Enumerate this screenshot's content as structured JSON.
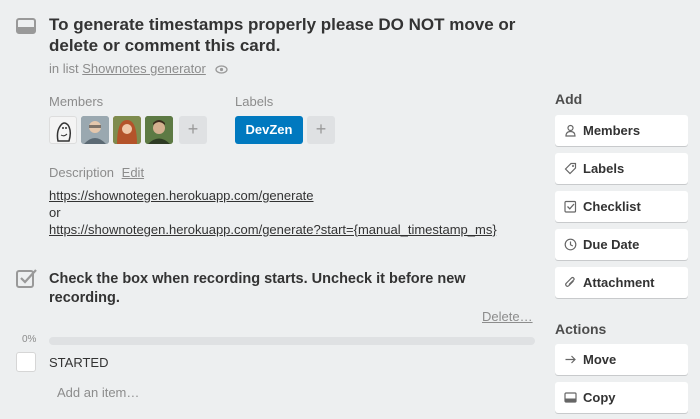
{
  "card": {
    "title": "To generate timestamps properly please DO NOT move or delete or comment this card.",
    "in_list_prefix": "in list",
    "list_name": "Shownotes generator"
  },
  "members": {
    "heading": "Members",
    "add": "+"
  },
  "labels": {
    "heading": "Labels",
    "items": [
      {
        "text": "DevZen",
        "color": "#0079bf"
      }
    ],
    "add": "+"
  },
  "description": {
    "heading": "Description",
    "edit": "Edit",
    "line1": "https://shownotegen.herokuapp.com/generate",
    "line2": "or",
    "line3": "https://shownotegen.herokuapp.com/generate?start={manual_timestamp_ms}"
  },
  "checklist": {
    "title": "Check the box when recording starts. Uncheck it before new recording.",
    "delete": "Delete…",
    "progress_label": "0%",
    "progress": 0,
    "items": [
      {
        "text": "STARTED",
        "checked": false
      }
    ],
    "add_placeholder": "Add an item…"
  },
  "sidebar": {
    "add_heading": "Add",
    "add_buttons": [
      {
        "label": "Members",
        "icon": "person-icon"
      },
      {
        "label": "Labels",
        "icon": "tag-icon"
      },
      {
        "label": "Checklist",
        "icon": "checklist-icon"
      },
      {
        "label": "Due Date",
        "icon": "clock-icon"
      },
      {
        "label": "Attachment",
        "icon": "paperclip-icon"
      }
    ],
    "actions_heading": "Actions",
    "action_buttons": [
      {
        "label": "Move",
        "icon": "arrow-right-icon"
      },
      {
        "label": "Copy",
        "icon": "copy-icon"
      }
    ]
  },
  "colors": {
    "background": "#edeff0",
    "label_blue": "#0079bf",
    "progress_green": "#5aac44"
  }
}
